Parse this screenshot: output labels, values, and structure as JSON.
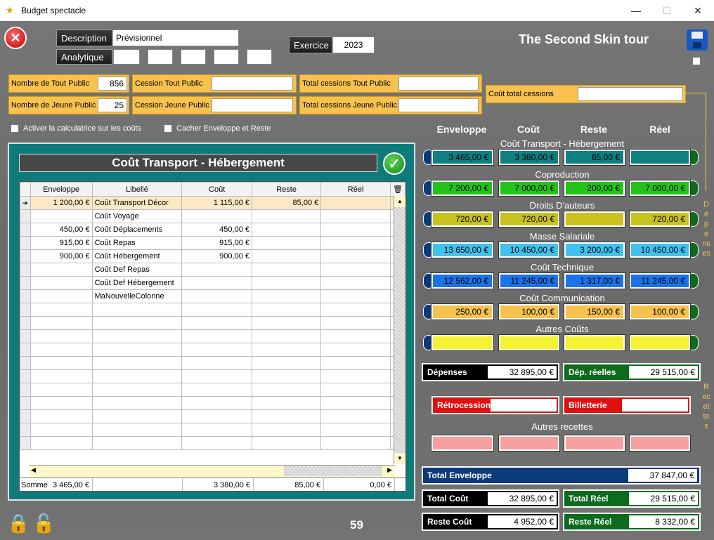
{
  "window": {
    "title": "Budget spectacle",
    "min_icon": "minimize-icon",
    "max_icon": "maximize-icon",
    "close_icon": "close-icon"
  },
  "header": {
    "description_label": "Description",
    "description_value": "Prévisionnel",
    "analytique_label": "Analytique",
    "exercice_label": "Exercice",
    "exercice_value": "2023",
    "tour_title": "The Second Skin tour"
  },
  "counts": {
    "tout_public_label": "Nombre de Tout Public",
    "tout_public_value": "856",
    "jeune_public_label": "Nombre de Jeune Public",
    "jeune_public_value": "25",
    "cession_tout_label": "Cession Tout Public",
    "cession_tout_value": "",
    "cession_jeune_label": "Cession  Jeune Public",
    "cession_jeune_value": "",
    "total_cess_tout_label": "Total cessions Tout Public",
    "total_cess_tout_value": "",
    "total_cess_jeune_label": "Total cessions Jeune Public",
    "total_cess_jeune_value": "",
    "cout_total_cessions_label": "Coût total cessions",
    "cout_total_cessions_value": ""
  },
  "options": {
    "calculatrice_label": "Activer la calculatrice sur les coûts",
    "cacher_label": "Cacher Enveloppe et Reste"
  },
  "panel": {
    "title": "Coût Transport - Hébergement",
    "columns": [
      "Enveloppe",
      "Libellé",
      "Coût",
      "Reste",
      "Réel"
    ],
    "rows": [
      [
        "1 200,00 €",
        "Coût Transport Décor",
        "1 115,00 €",
        "85,00 €",
        ""
      ],
      [
        "",
        "Coût Voyage",
        "",
        "",
        ""
      ],
      [
        "450,00 €",
        "Coût Déplacements",
        "450,00 €",
        "",
        ""
      ],
      [
        "915,00 €",
        "Coût Repas",
        "915,00 €",
        "",
        ""
      ],
      [
        "900,00 €",
        "Coût Hébergement",
        "900,00 €",
        "",
        ""
      ],
      [
        "",
        "Coût Def Repas",
        "",
        "",
        ""
      ],
      [
        "",
        "Coût Def Hébergement",
        "",
        "",
        ""
      ],
      [
        "",
        "MaNouvelleColonne",
        "",
        "",
        ""
      ]
    ],
    "sum_label": "Somme",
    "sum_enveloppe": "3 465,00 €",
    "sum_cout": "3 380,00 €",
    "sum_reste": "85,00 €",
    "sum_reel": "0,00 €"
  },
  "summary": {
    "col_headers": [
      "Enveloppe",
      "Coût",
      "Reste",
      "Réel"
    ],
    "sections": [
      {
        "name": "Coût Transport - Hébergement",
        "color": "#0f8080",
        "values": [
          "3 465,00 €",
          "3 380,00 €",
          "85,00 €",
          ""
        ]
      },
      {
        "name": "Coproduction",
        "color": "#22c41a",
        "values": [
          "7 200,00 €",
          "7 000,00 €",
          "200,00 €",
          "7 000,00 €"
        ]
      },
      {
        "name": "Droits D'auteurs",
        "color": "#c9c21c",
        "values": [
          "720,00 €",
          "720,00 €",
          "",
          "720,00 €"
        ]
      },
      {
        "name": "Masse Salariale",
        "color": "#3fc3ee",
        "values": [
          "13 650,00 €",
          "10 450,00 €",
          "3 200,00 €",
          "10 450,00 €"
        ]
      },
      {
        "name": "Coût Technique",
        "color": "#1a73e8",
        "values": [
          "12 562,00 €",
          "11 245,00 €",
          "1 317,00 €",
          "11 245,00 €"
        ]
      },
      {
        "name": "Coût Communication",
        "color": "#f7c24d",
        "values": [
          "250,00 €",
          "100,00 €",
          "150,00 €",
          "100,00 €"
        ]
      },
      {
        "name": "Autres Coûts",
        "color": "#f3f333",
        "values": [
          "",
          "",
          "",
          ""
        ]
      }
    ],
    "depenses_side": "Dépenses",
    "recettes_side": "Recettes",
    "depenses_label": "Dépenses",
    "depenses_value": "32 895,00 €",
    "dep_reelles_label": "Dép. réelles",
    "dep_reelles_value": "29 515,00 €",
    "retrocession_label": "Rétrocession",
    "retrocession_value": "",
    "billetterie_label": "Billetterie",
    "billetterie_value": "",
    "autres_recettes_label": "Autres recettes",
    "autres_recettes_values": [
      "",
      "",
      "",
      ""
    ],
    "total_enveloppe_label": "Total Enveloppe",
    "total_enveloppe_value": "37 847,00 €",
    "total_cout_label": "Total Coût",
    "total_cout_value": "32 895,00 €",
    "total_reel_label": "Total Réel",
    "total_reel_value": "29 515,00 €",
    "reste_cout_label": "Reste Coût",
    "reste_cout_value": "4 952,00 €",
    "reste_reel_label": "Reste Réel",
    "reste_reel_value": "8 332,00 €"
  },
  "footer": {
    "counter": "59"
  },
  "colors": {
    "panel": "#0f7a7a",
    "orange": "#f7c24d",
    "navy": "#0b3a7a",
    "green": "#0c6b1c",
    "red": "#e01010",
    "pink": "#f7a0a0"
  }
}
